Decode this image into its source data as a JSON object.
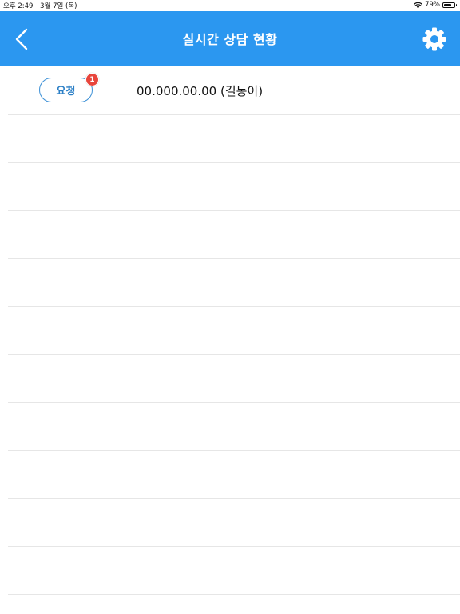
{
  "status_bar": {
    "time": "오후 2:49",
    "date": "3월 7일 (목)",
    "battery": "79%",
    "battery_level": 0.79
  },
  "nav": {
    "title": "실시간 상담 현황",
    "back_icon": "chevron-left-icon",
    "settings_icon": "gear-icon"
  },
  "colors": {
    "nav_background": "#2b97f0",
    "button_border": "#3a8fd6",
    "badge": "#e8453c",
    "divider": "#e6e6e6"
  },
  "list": {
    "items": [
      {
        "button_label": "요청",
        "badge_count": "1",
        "text": "00.000.00.00 (길동이)"
      }
    ]
  }
}
